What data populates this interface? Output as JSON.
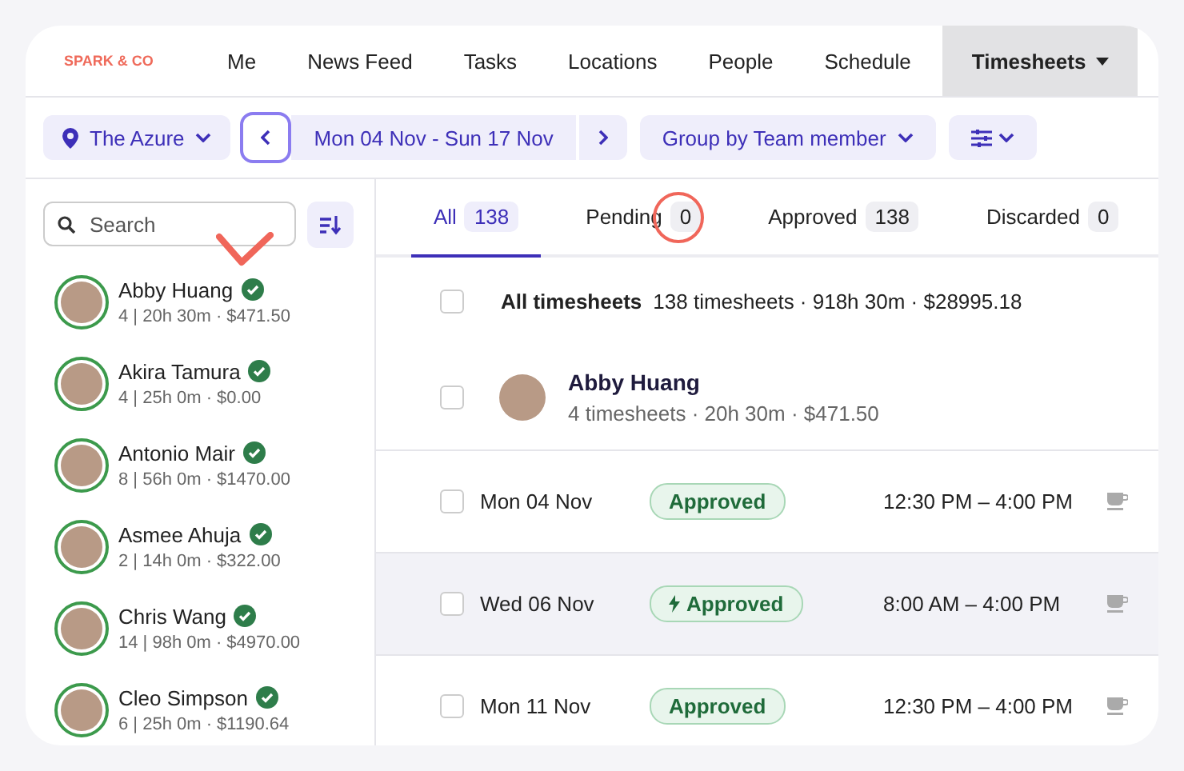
{
  "logo": "SPARK & CO",
  "nav": [
    {
      "label": "Me",
      "selected": false
    },
    {
      "label": "News Feed",
      "selected": false
    },
    {
      "label": "Tasks",
      "selected": false
    },
    {
      "label": "Locations",
      "selected": false
    },
    {
      "label": "People",
      "selected": false
    },
    {
      "label": "Schedule",
      "selected": false
    },
    {
      "label": "Timesheets",
      "selected": true
    }
  ],
  "toolbar": {
    "location": "The Azure",
    "date_range": "Mon 04 Nov - Sun 17 Nov",
    "group_by": "Group by Team member"
  },
  "sidebar": {
    "search": {
      "placeholder": "Search"
    },
    "people": [
      {
        "name": "Abby Huang",
        "stats": "4 | 20h 30m · $471.50",
        "approved": true
      },
      {
        "name": "Akira Tamura",
        "stats": "4 | 25h 0m · $0.00",
        "approved": true
      },
      {
        "name": "Antonio Mair",
        "stats": "8 | 56h 0m · $1470.00",
        "approved": true
      },
      {
        "name": "Asmee Ahuja",
        "stats": "2 | 14h 0m · $322.00",
        "approved": true
      },
      {
        "name": "Chris Wang",
        "stats": "14 | 98h 0m · $4970.00",
        "approved": true
      },
      {
        "name": "Cleo Simpson",
        "stats": "6 | 25h 0m · $1190.64",
        "approved": true
      }
    ]
  },
  "tabs": [
    {
      "label": "All",
      "count": "138",
      "selected": true
    },
    {
      "label": "Pending",
      "count": "0",
      "selected": false
    },
    {
      "label": "Approved",
      "count": "138",
      "selected": false
    },
    {
      "label": "Discarded",
      "count": "0",
      "selected": false
    }
  ],
  "summary": {
    "title": "All timesheets",
    "details": "138 timesheets · 918h 30m · $28995.18",
    "checked": false
  },
  "group": {
    "name": "Abby Huang",
    "details": "4 timesheets · 20h 30m · $471.50",
    "checked": false
  },
  "entries": [
    {
      "date": "Mon 04 Nov",
      "status": "Approved",
      "auto": false,
      "time": "12:30 PM – 4:00 PM",
      "checked": false,
      "highlighted": false
    },
    {
      "date": "Wed 06 Nov",
      "status": "Approved",
      "auto": true,
      "time": "8:00 AM – 4:00 PM",
      "checked": false,
      "highlighted": true
    },
    {
      "date": "Mon 11 Nov",
      "status": "Approved",
      "auto": false,
      "time": "12:30 PM – 4:00 PM",
      "checked": false,
      "highlighted": false
    }
  ]
}
